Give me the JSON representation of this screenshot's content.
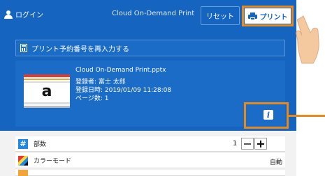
{
  "header": {
    "login_label": "ログイン",
    "app_title": "Cloud On-Demand Print",
    "reset_label": "リセット",
    "print_label": "プリント"
  },
  "reenter": {
    "label": "プリント予約番号を再入力する"
  },
  "document": {
    "thumbnail_letter": "a",
    "file_name": "Cloud On-Demand Print.pptx",
    "registrant": "登録者: 富士 太郎",
    "registered_at": "登録日時: 2019/01/09 11:28:08",
    "pages": "ページ数: 1",
    "info_icon_glyph": "i"
  },
  "settings": {
    "copies": {
      "label": "部数",
      "value": "1",
      "icon_glyph": "#"
    },
    "color_mode": {
      "label": "カラーモード",
      "value": "自動"
    }
  },
  "colors": {
    "primary_blue": "#1565c0",
    "panel_blue": "#1a6cc6",
    "highlight_orange": "#e8891a",
    "hand_skin": "#f4c9a0"
  }
}
